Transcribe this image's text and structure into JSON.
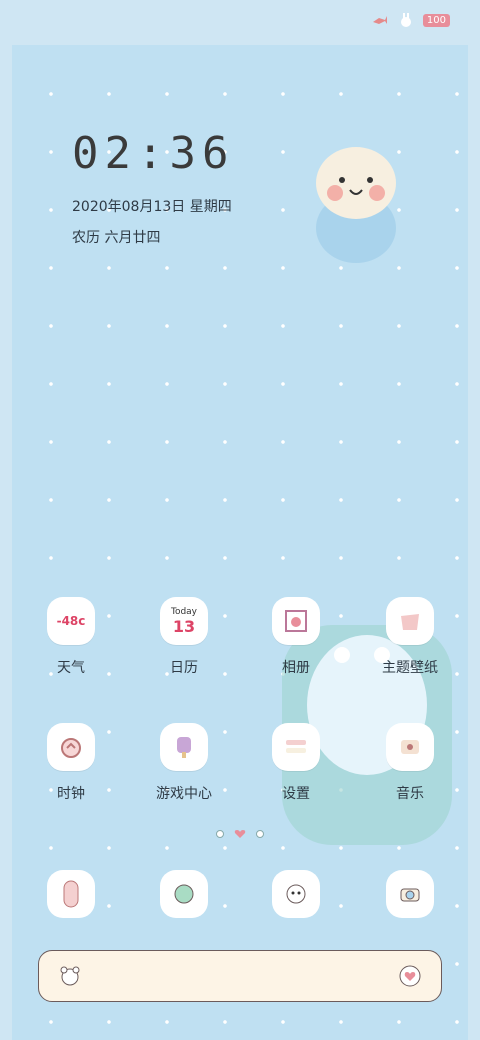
{
  "status": {
    "battery": "100"
  },
  "clock": {
    "time": "02:36",
    "date": "2020年08月13日  星期四",
    "lunar": "农历  六月廿四"
  },
  "apps": [
    {
      "label": "天气",
      "icon": "weather-icon",
      "badge": "-48c"
    },
    {
      "label": "日历",
      "icon": "calendar-icon",
      "badge": "13",
      "badge_top": "Today"
    },
    {
      "label": "相册",
      "icon": "gallery-icon"
    },
    {
      "label": "主题壁纸",
      "icon": "theme-icon"
    },
    {
      "label": "时钟",
      "icon": "clock-icon"
    },
    {
      "label": "游戏中心",
      "icon": "game-center-icon"
    },
    {
      "label": "设置",
      "icon": "settings-icon"
    },
    {
      "label": "音乐",
      "icon": "music-icon"
    }
  ],
  "dock": [
    {
      "icon": "phone-icon"
    },
    {
      "icon": "messages-icon"
    },
    {
      "icon": "browser-icon"
    },
    {
      "icon": "camera-icon"
    }
  ],
  "colors": {
    "wallpaper": "#bfe0f2",
    "accent": "#e88e9a",
    "text": "#2f3b46"
  }
}
